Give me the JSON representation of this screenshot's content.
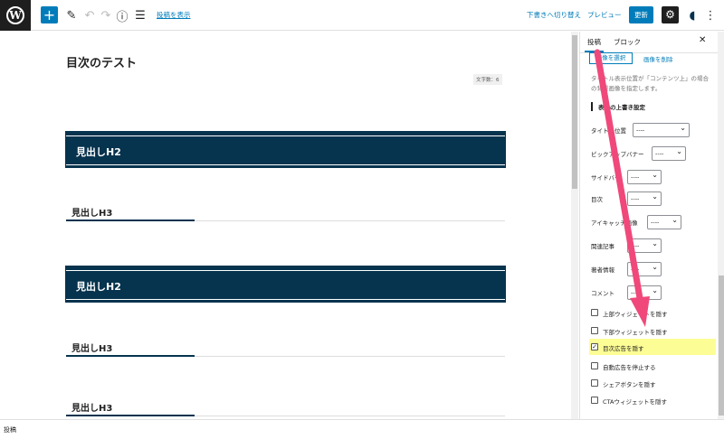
{
  "toolbar": {
    "toggle_label": "投稿を表示",
    "draft_switch": "下書きへ切り替え",
    "preview": "プレビュー",
    "update": "更新"
  },
  "editor": {
    "title": "目次のテスト",
    "word_count": "文字数：6",
    "blocks": [
      {
        "type": "h2",
        "text": "見出しH2"
      },
      {
        "type": "h3",
        "text": "見出しH3"
      },
      {
        "type": "h2",
        "text": "見出しH2"
      },
      {
        "type": "h3",
        "text": "見出しH3"
      },
      {
        "type": "h3",
        "text": "見出しH3"
      }
    ]
  },
  "sidebar": {
    "tabs": [
      "投稿",
      "ブロック"
    ],
    "active_tab": "投稿",
    "image_select": "画像を選択",
    "image_delete": "画像を削除",
    "note": "タイトル表示位置が「コンテンツ上」の場合の背景画像を指定します。",
    "section_heading": "表示の上書き設定",
    "fields": [
      {
        "label": "タイトル位置",
        "value": "----"
      },
      {
        "label": "ピックアップバナー",
        "value": "----"
      },
      {
        "label": "サイドバー",
        "value": "----"
      },
      {
        "label": "目次",
        "value": "----"
      },
      {
        "label": "アイキャッチ画像",
        "value": "----"
      },
      {
        "label": "関連記事",
        "value": "----"
      },
      {
        "label": "著者情報",
        "value": "----"
      },
      {
        "label": "コメント",
        "value": "----"
      }
    ],
    "checkboxes": [
      {
        "label": "上部ウィジェットを隠す",
        "checked": false
      },
      {
        "label": "下部ウィジェットを隠す",
        "checked": false
      },
      {
        "label": "目次広告を隠す",
        "checked": true
      },
      {
        "label": "自動広告を停止する",
        "checked": false
      },
      {
        "label": "シェアボタンを隠す",
        "checked": false
      },
      {
        "label": "CTAウィジェットを隠す",
        "checked": false
      }
    ]
  },
  "footer": {
    "breadcrumb": "投稿"
  },
  "colors": {
    "accent": "#007cba",
    "heading_bg": "#06334e",
    "highlight": "#fdfd96",
    "arrow": "#f0487a"
  }
}
